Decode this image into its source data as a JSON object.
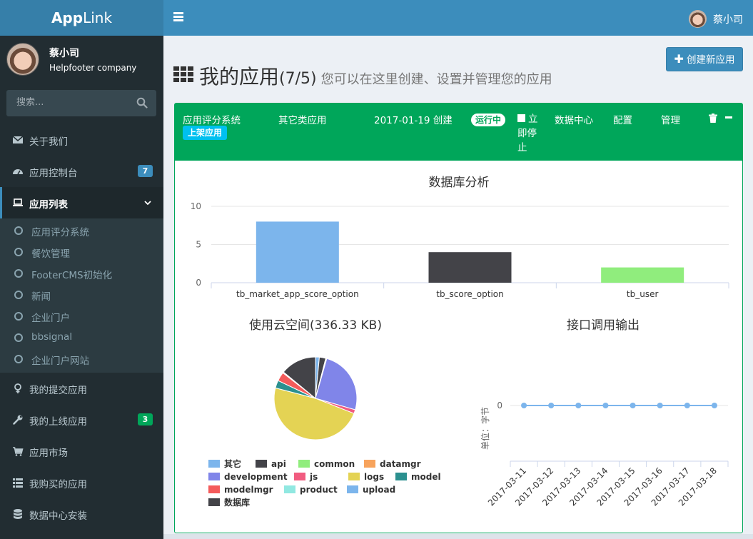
{
  "brand": {
    "bold": "App",
    "light": "Link"
  },
  "user": {
    "name": "蔡小司",
    "company": "Helpfooter company"
  },
  "search": {
    "placeholder": "搜索..."
  },
  "menu": [
    {
      "label": "关于我们",
      "icon": "envelope-icon"
    },
    {
      "label": "应用控制台",
      "icon": "dashboard-icon",
      "badge": "7",
      "badge_color": "#3c8dbc"
    },
    {
      "label": "应用列表",
      "icon": "laptop-icon",
      "active": true
    },
    {
      "label": "我的提交应用",
      "icon": "venus-icon"
    },
    {
      "label": "我的上线应用",
      "icon": "wrench-icon",
      "badge": "3",
      "badge_color": "#00a65a"
    },
    {
      "label": "应用市场",
      "icon": "cart-icon"
    },
    {
      "label": "我购买的应用",
      "icon": "list-icon"
    },
    {
      "label": "数据中心安装",
      "icon": "database-icon"
    }
  ],
  "submenu": [
    "应用评分系统",
    "餐饮管理",
    "FooterCMS初始化",
    "新闻",
    "企业门户",
    "bbsignal",
    "企业门户网站"
  ],
  "header": {
    "user_name": "蔡小司"
  },
  "page": {
    "title": "我的应用",
    "count": "(7/5)",
    "subtitle": "您可以在这里创建、设置并管理您的应用",
    "create_label": "创建新应用"
  },
  "app": {
    "name": "应用评分系统",
    "badge": "上架应用",
    "type": "其它类应用",
    "date": "2017-01-19 创建",
    "status": "运行中",
    "stop_label": "立即停止",
    "data_center": "数据中心",
    "config": "配置",
    "manage": "管理"
  },
  "colors": {
    "green": "#00a65a",
    "blue": "#3c8dbc",
    "cyan": "#00c0ef"
  },
  "chart_data": [
    {
      "type": "bar",
      "title": "数据库分析",
      "categories": [
        "tb_market_app_score_option",
        "tb_score_option",
        "tb_user"
      ],
      "values": [
        8,
        4,
        2
      ],
      "colors": [
        "#7cb5ec",
        "#434348",
        "#90ed7d"
      ],
      "ylim": [
        0,
        10
      ],
      "yticks": [
        0,
        5,
        10
      ]
    },
    {
      "type": "pie",
      "title": "使用云空间(336.33 KB)",
      "slices": [
        {
          "name": "其它",
          "value": 1.5,
          "color": "#7cb5ec"
        },
        {
          "name": "api",
          "value": 2.5,
          "color": "#434348"
        },
        {
          "name": "common",
          "value": 0.2,
          "color": "#90ed7d"
        },
        {
          "name": "datamgr",
          "value": 0.2,
          "color": "#f7a35c"
        },
        {
          "name": "development",
          "value": 25,
          "color": "#8085e9"
        },
        {
          "name": "js",
          "value": 1.5,
          "color": "#f15c80"
        },
        {
          "name": "logs",
          "value": 48,
          "color": "#e4d354"
        },
        {
          "name": "model",
          "value": 3,
          "color": "#2b908f"
        },
        {
          "name": "modelmgr",
          "value": 3.5,
          "color": "#f45b5b"
        },
        {
          "name": "product",
          "value": 0.2,
          "color": "#91e8e1"
        },
        {
          "name": "upload",
          "value": 0.2,
          "color": "#7cb5ec"
        },
        {
          "name": "数据库",
          "value": 14,
          "color": "#434348"
        }
      ]
    },
    {
      "type": "line",
      "title": "接口调用输出",
      "ylabel": "单位：字节",
      "x": [
        "2017-03-11",
        "2017-03-12",
        "2017-03-13",
        "2017-03-14",
        "2017-03-15",
        "2017-03-16",
        "2017-03-17",
        "2017-03-18"
      ],
      "values": [
        0,
        0,
        0,
        0,
        0,
        0,
        0,
        0
      ],
      "yticks": [
        0
      ],
      "color": "#7cb5ec"
    }
  ]
}
